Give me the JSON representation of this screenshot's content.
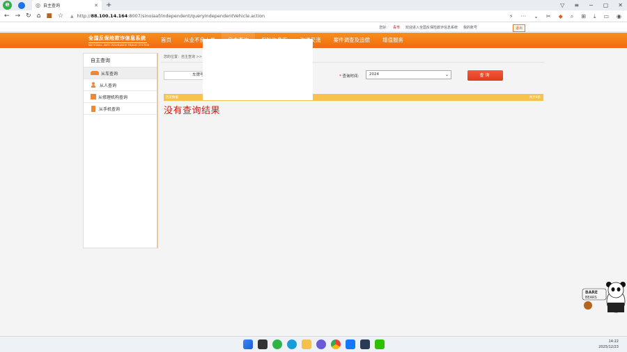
{
  "browser": {
    "tab_title": "自主查询",
    "url_host": "88.100.14.164",
    "url_rest": ":8007/sinoiaaf/independent/queryIndependentVehicle.action"
  },
  "util_bar": {
    "greeting": "您好:",
    "city": "青市",
    "welcome": "欢迎进入全国反保险欺诈信息系统",
    "account": "我的账号",
    "exit": "退出"
  },
  "site": {
    "brand_cn": "全国反保险欺诈信息系统",
    "brand_en": "NATIONAL ANTI INSURANCE FRAUD SYSTEM",
    "nav": [
      "首页",
      "从业不良人员",
      "自主查询",
      "保险信息库",
      "沟通交流",
      "案件调查及追偿",
      "增值服务"
    ]
  },
  "sidebar": {
    "title": "自主查询",
    "items": [
      {
        "label": "从车查询",
        "icon": "car-icon"
      },
      {
        "label": "从人查询",
        "icon": "person-icon"
      },
      {
        "label": "从修理机构查询",
        "icon": "building-icon"
      },
      {
        "label": "从手机查询",
        "icon": "phone-icon"
      }
    ]
  },
  "main": {
    "breadcrumb": "您的位置：自主查询 >>",
    "plate_label": "车牌号",
    "query_time_label": "查询时间:",
    "query_time_req": "*",
    "query_time_value": "2024",
    "search_label": "查询",
    "result_left": "历史数据",
    "result_right": "共计0条",
    "no_result": "没有查询结果"
  },
  "taskbar": {
    "time": "14:22",
    "date": "2025/12/23"
  }
}
